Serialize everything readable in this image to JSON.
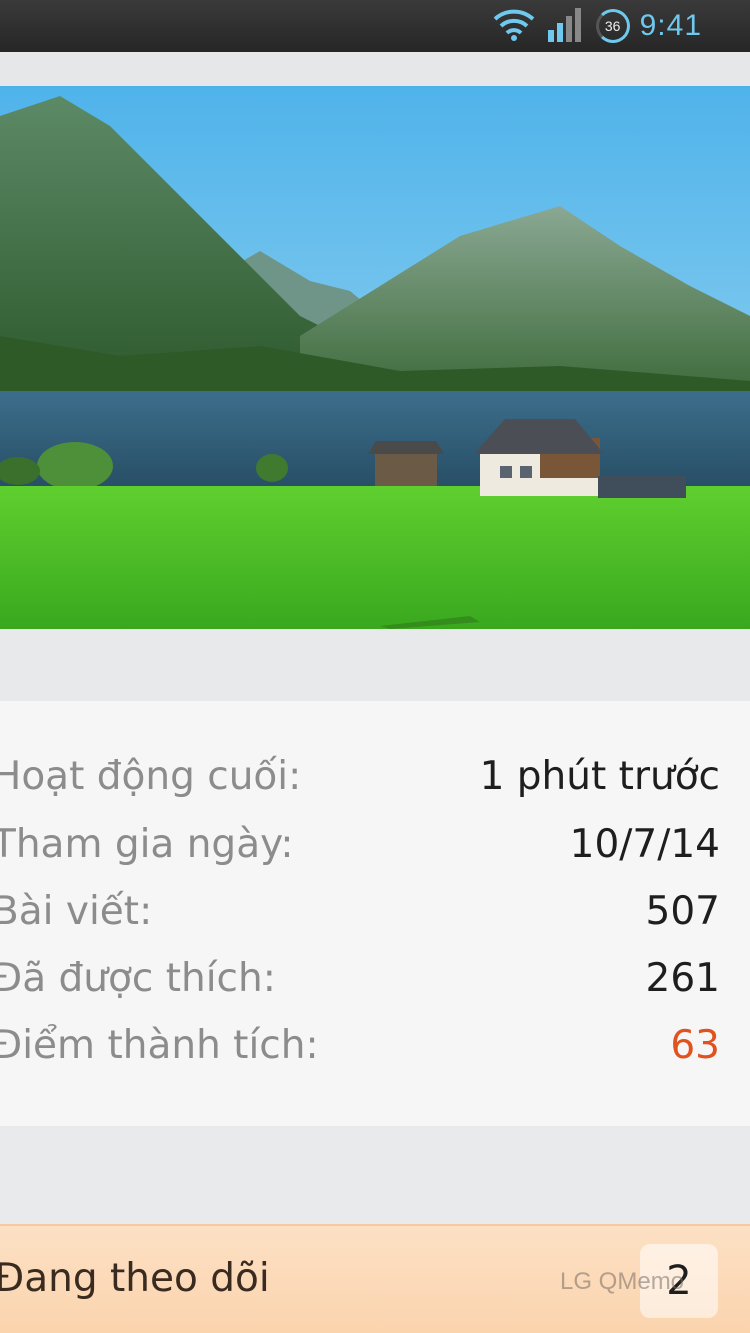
{
  "status_bar": {
    "time": "9:41",
    "battery_level": "36",
    "icons": [
      "wifi-icon",
      "signal-icon",
      "battery-icon"
    ]
  },
  "stats": {
    "rows": [
      {
        "label": "Hoạt động cuối:",
        "value": "1 phút trước"
      },
      {
        "label": "Tham gia ngày:",
        "value": "10/7/14"
      },
      {
        "label": "Bài viết:",
        "value": "507"
      },
      {
        "label": "Đã được thích:",
        "value": "261"
      },
      {
        "label": "Điểm thành tích:",
        "value": "63"
      }
    ]
  },
  "following": {
    "label": "Đang theo dõi",
    "count": "2"
  },
  "watermark": "LG QMemo",
  "colors": {
    "accent": "#e0521e",
    "status_time": "#6fc8ee",
    "following_bg": "#fbd9b8"
  }
}
